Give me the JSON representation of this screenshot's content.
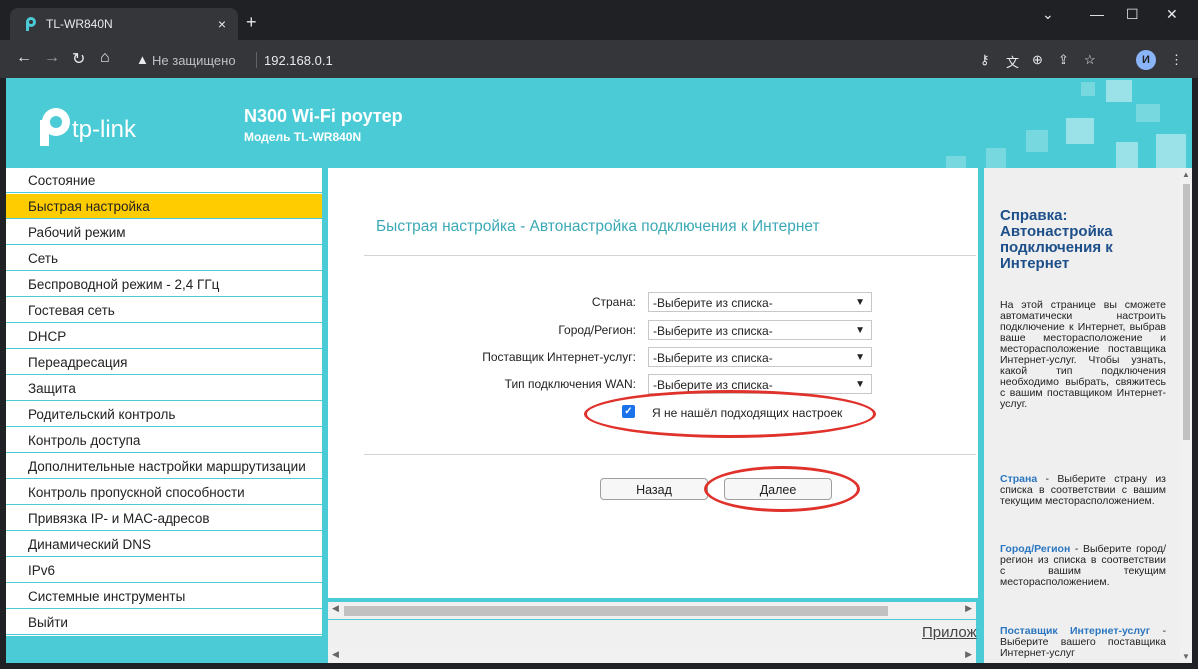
{
  "browser": {
    "tab_title": "TL-WR840N",
    "tab_close": "×",
    "new_tab": "+",
    "security_text": "Не защищено",
    "url": "192.168.0.1",
    "profile_initial": "И"
  },
  "header": {
    "logo_text": "tp-link",
    "product_title": "N300 Wi-Fi роутер",
    "model_text": "Модель TL-WR840N"
  },
  "sidebar": {
    "items": [
      {
        "label": "Состояние"
      },
      {
        "label": "Быстрая настройка"
      },
      {
        "label": "Рабочий режим"
      },
      {
        "label": "Сеть"
      },
      {
        "label": "Беспроводной режим - 2,4 ГГц"
      },
      {
        "label": "Гостевая сеть"
      },
      {
        "label": "DHCP"
      },
      {
        "label": "Переадресация"
      },
      {
        "label": "Защита"
      },
      {
        "label": "Родительский контроль"
      },
      {
        "label": "Контроль доступа"
      },
      {
        "label": "Дополнительные настройки маршрутизации"
      },
      {
        "label": "Контроль пропускной способности"
      },
      {
        "label": "Привязка IP- и MAC-адресов"
      },
      {
        "label": "Динамический DNS"
      },
      {
        "label": "IPv6"
      },
      {
        "label": "Системные инструменты"
      },
      {
        "label": "Выйти"
      }
    ],
    "active_index": 1
  },
  "main": {
    "title": "Быстрая настройка - Автонастройка подключения к Интернет",
    "fields": [
      {
        "label": "Страна:",
        "value": "-Выберите из списка-"
      },
      {
        "label": "Город/Регион:",
        "value": "-Выберите из списка-"
      },
      {
        "label": "Поставщик Интернет-услуг:",
        "value": "-Выберите из списка-"
      },
      {
        "label": "Тип подключения WAN:",
        "value": "-Выберите из списка-"
      }
    ],
    "checkbox_label": "Я не нашёл подходящих настроек",
    "checkbox_checked": true,
    "back_label": "Назад",
    "next_label": "Далее",
    "lower_link": "Прилож"
  },
  "help": {
    "title": "Справка: Автонастройка подключения к Интернет",
    "intro": "На этой странице вы сможете автоматически настроить подключение к Интернет, выбрав ваше месторасположение и месторасположение поставщика Интернет-услуг. Чтобы узнать, какой тип подключения необходимо выбрать, свяжитесь с вашим поставщиком Интернет-услуг.",
    "country_key": "Страна",
    "country_text": " - Выберите страну из списка в соответствии с вашим текущим месторасположением.",
    "city_key": "Город/Регион",
    "city_text": " - Выберите город/регион из списка в соответствии с вашим текущим месторасположением.",
    "isp_key": "Поставщик Интернет-услуг",
    "isp_text": " - Выберите вашего поставщика Интернет-услуг"
  },
  "colors": {
    "brand": "#4acbd6",
    "active_menu": "#ffcc00",
    "title_accent": "#3aa9b5",
    "annotation": "#e0312b"
  }
}
